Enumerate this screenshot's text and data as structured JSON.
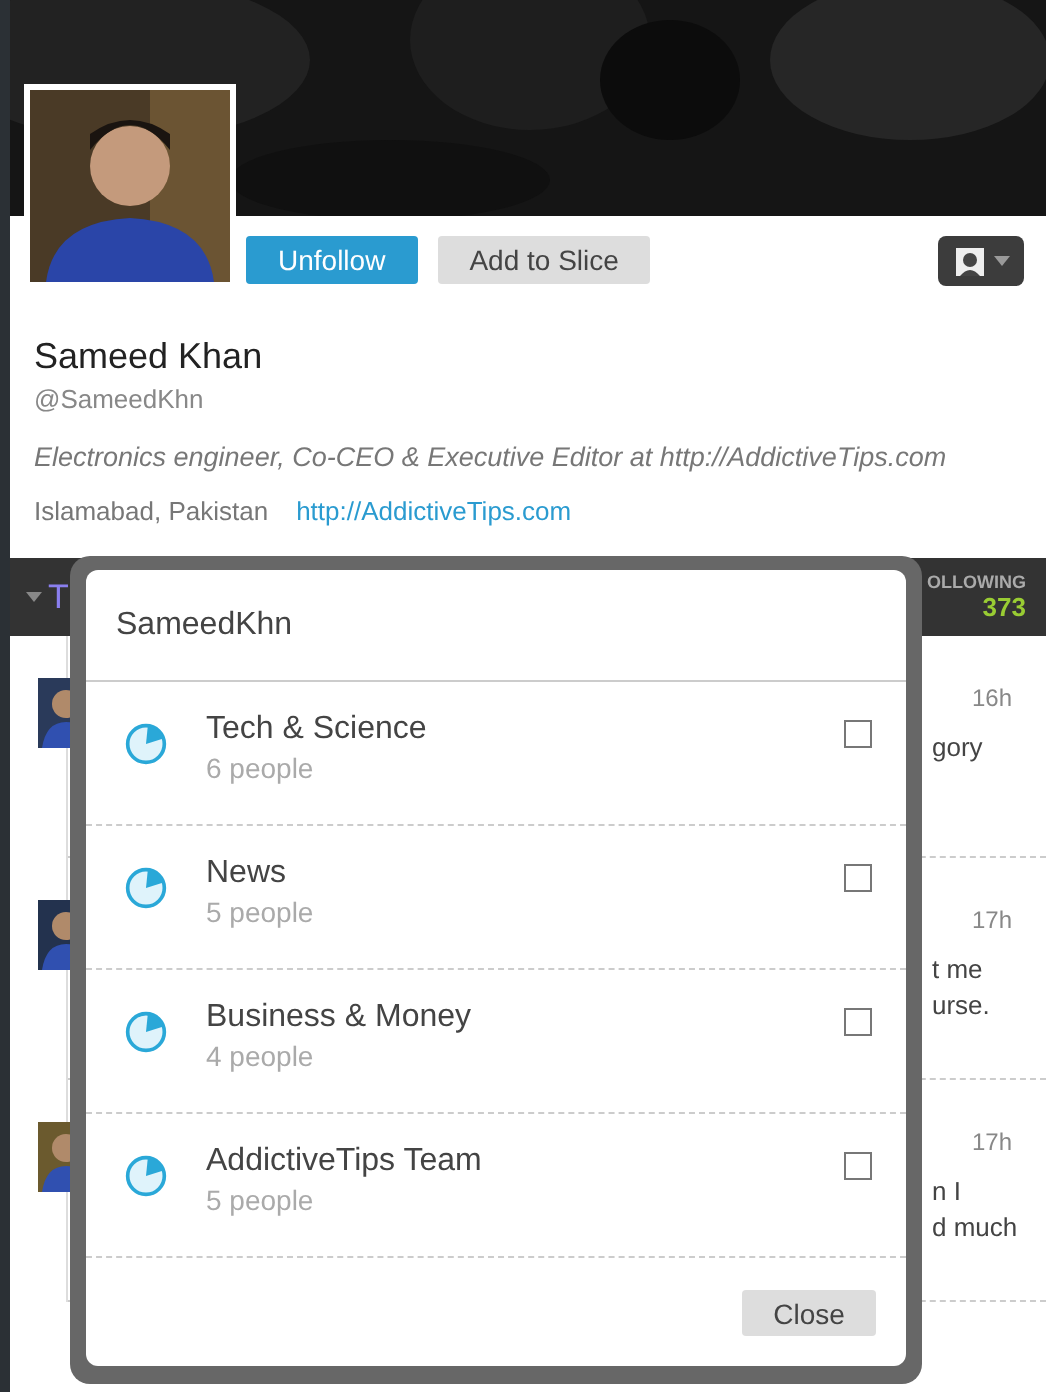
{
  "profile": {
    "name": "Sameed Khan",
    "handle": "@SameedKhn",
    "bio": "Electronics engineer, Co-CEO & Executive Editor at http://AddictiveTips.com",
    "location": "Islamabad, Pakistan",
    "website": "http://AddictiveTips.com",
    "follow_button": "Unfollow",
    "slice_button": "Add to Slice"
  },
  "bar": {
    "tab": "T",
    "following_label": "OLLOWING",
    "following_count": "373"
  },
  "feed": [
    {
      "time": "16h",
      "lines": [
        "gory"
      ]
    },
    {
      "time": "17h",
      "lines": [
        "t me",
        "urse."
      ]
    },
    {
      "time": "17h",
      "lines": [
        "n I",
        "d much"
      ]
    }
  ],
  "dialog": {
    "title": "SameedKhn",
    "lists": [
      {
        "name": "Tech & Science",
        "count": "6 people",
        "checked": false
      },
      {
        "name": "News",
        "count": "5 people",
        "checked": false
      },
      {
        "name": "Business & Money",
        "count": "4 people",
        "checked": false
      },
      {
        "name": "AddictiveTips Team",
        "count": "5 people",
        "checked": false
      }
    ],
    "close": "Close"
  }
}
